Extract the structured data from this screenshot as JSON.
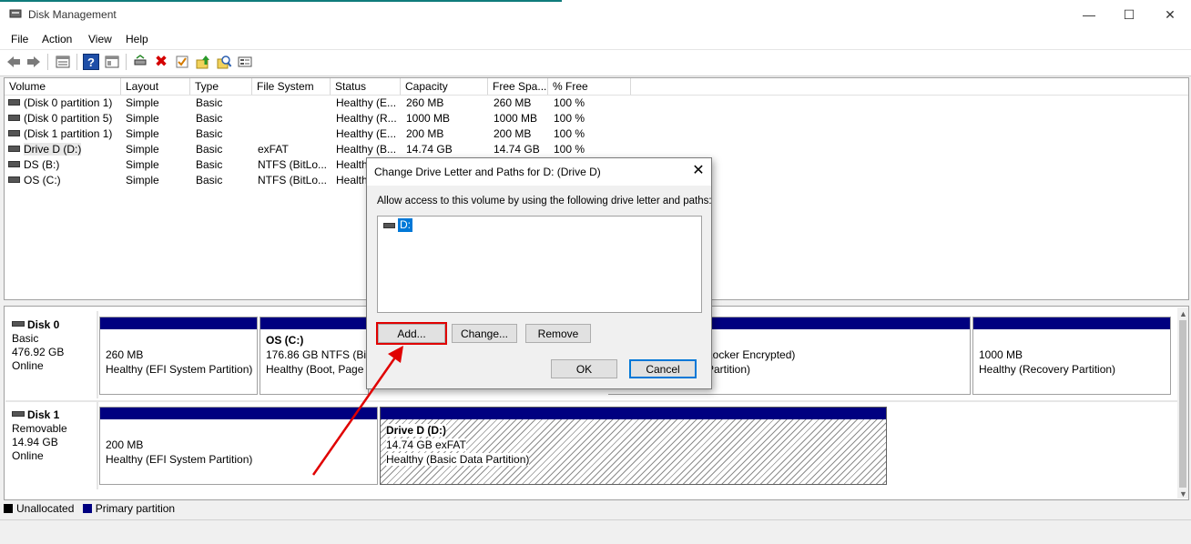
{
  "window": {
    "title": "Disk Management",
    "controls": {
      "minimize": "—",
      "maximize": "☐",
      "close": "✕"
    }
  },
  "menu": [
    "File",
    "Action",
    "View",
    "Help"
  ],
  "toolbar": {
    "icons": [
      "back-arrow-icon",
      "forward-arrow-icon",
      "list-view-icon",
      "help-icon",
      "properties-icon",
      "connect-icon",
      "delete-icon",
      "checkmark-icon",
      "upload-icon",
      "search-icon",
      "details-icon"
    ],
    "delete_glyph": "✖",
    "help_glyph": "?"
  },
  "volume_list": {
    "columns": [
      "Volume",
      "Layout",
      "Type",
      "File System",
      "Status",
      "Capacity",
      "Free Spa...",
      "% Free"
    ],
    "rows": [
      [
        "(Disk 0 partition 1)",
        "Simple",
        "Basic",
        "",
        "Healthy (E...",
        "260 MB",
        "260 MB",
        "100 %"
      ],
      [
        "(Disk 0 partition 5)",
        "Simple",
        "Basic",
        "",
        "Healthy (R...",
        "1000 MB",
        "1000 MB",
        "100 %"
      ],
      [
        "(Disk 1 partition 1)",
        "Simple",
        "Basic",
        "",
        "Healthy (E...",
        "200 MB",
        "200 MB",
        "100 %"
      ],
      [
        "Drive D (D:)",
        "Simple",
        "Basic",
        "exFAT",
        "Healthy (B...",
        "14.74 GB",
        "14.74 GB",
        "100 %"
      ],
      [
        "DS (B:)",
        "Simple",
        "Basic",
        "NTFS (BitLo...",
        "Health",
        "",
        "",
        ""
      ],
      [
        "OS (C:)",
        "Simple",
        "Basic",
        "NTFS (BitLo...",
        "Health",
        "",
        "",
        ""
      ]
    ]
  },
  "disks": [
    {
      "name": "Disk 0",
      "type": "Basic",
      "size": "476.92 GB",
      "status": "Online",
      "partitions": [
        {
          "title": "",
          "line1": "260 MB",
          "line2": "Healthy (EFI System Partition)"
        },
        {
          "title": "OS  (C:)",
          "line1": "176.86 GB NTFS (BitL",
          "line2": "Healthy (Boot, Page F"
        },
        {
          "title": "",
          "line1": "Locker Encrypted)",
          "line2": "Partition)"
        },
        {
          "title": "",
          "line1": "1000 MB",
          "line2": "Healthy (Recovery Partition)"
        }
      ]
    },
    {
      "name": "Disk 1",
      "type": "Removable",
      "size": "14.94 GB",
      "status": "Online",
      "partitions": [
        {
          "title": "",
          "line1": "200 MB",
          "line2": "Healthy (EFI System Partition)"
        },
        {
          "title": "Drive D  (D:)",
          "line1": "14.74 GB exFAT",
          "line2": "Healthy (Basic Data Partition)"
        }
      ]
    }
  ],
  "legend": [
    {
      "label": "Unallocated",
      "color": "#000000"
    },
    {
      "label": "Primary partition",
      "color": "#000080"
    }
  ],
  "dialog": {
    "title": "Change Drive Letter and Paths for D: (Drive D)",
    "description": "Allow access to this volume by using the following drive letter and paths:",
    "items": [
      "D:"
    ],
    "buttons": {
      "add": "Add...",
      "change": "Change...",
      "remove": "Remove",
      "ok": "OK",
      "cancel": "Cancel"
    }
  },
  "colors": {
    "accent": "#0078d7",
    "partition_bar": "#000080",
    "annotation": "#e00000"
  }
}
